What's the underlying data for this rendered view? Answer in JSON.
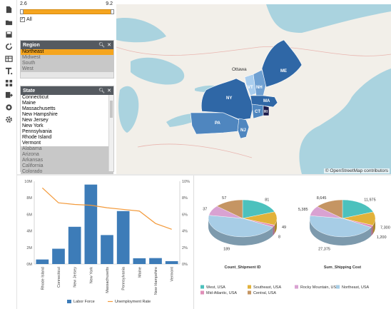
{
  "slider": {
    "min_label": "2.6",
    "max_label": "9.2"
  },
  "all_checkbox": {
    "label": "All",
    "checked": "✓"
  },
  "region_listbox": {
    "title": "Region",
    "items": [
      {
        "label": "Northeast",
        "state": "selected"
      },
      {
        "label": "Midwest",
        "state": "excluded"
      },
      {
        "label": "South",
        "state": "excluded"
      },
      {
        "label": "West",
        "state": "excluded"
      }
    ]
  },
  "state_listbox": {
    "title": "State",
    "items": [
      {
        "label": "Connecticut",
        "state": "possible"
      },
      {
        "label": "Maine",
        "state": "possible"
      },
      {
        "label": "Massachusetts",
        "state": "possible"
      },
      {
        "label": "New Hampshire",
        "state": "possible"
      },
      {
        "label": "New Jersey",
        "state": "possible"
      },
      {
        "label": "New York",
        "state": "possible"
      },
      {
        "label": "Pennsylvania",
        "state": "possible"
      },
      {
        "label": "Rhode Island",
        "state": "possible"
      },
      {
        "label": "Vermont",
        "state": "possible"
      },
      {
        "label": "Alabama",
        "state": "excluded"
      },
      {
        "label": "Arizona",
        "state": "excluded"
      },
      {
        "label": "Arkansas",
        "state": "excluded"
      },
      {
        "label": "California",
        "state": "excluded"
      },
      {
        "label": "Colorado",
        "state": "excluded"
      }
    ]
  },
  "toolbar_icons": [
    "new-sheet-icon",
    "open-folder-icon",
    "save-icon",
    "reload-icon",
    "table-box-icon",
    "text-object-icon",
    "grid-layout-icon",
    "export-icon",
    "network-icon",
    "settings-icon"
  ],
  "map": {
    "attribution": "© OpenStreetMap contributors",
    "city_label": "Ottawa",
    "state_labels": [
      "ME",
      "VT",
      "NH",
      "NY",
      "MA",
      "CT",
      "RI",
      "PA",
      "NJ"
    ],
    "shade_colors": {
      "dark": "#2f67a6",
      "mid": "#4f86bf",
      "light": "#6fa0d2",
      "pale": "#a9cdee",
      "rhode_island": "#1a1a4a"
    }
  },
  "chart_data": [
    {
      "type": "bar",
      "categories": [
        "Rhode Island",
        "Connecticut",
        "New Jersey",
        "New York",
        "Massachusetts",
        "Pennsylvania",
        "Maine",
        "New Hampshire",
        "Vermont"
      ],
      "series": [
        {
          "name": "Labor Force",
          "kind": "bar",
          "axis": "left",
          "color": "#3d7cb8",
          "values": [
            0.55,
            1.85,
            4.5,
            9.6,
            3.5,
            6.4,
            0.7,
            0.72,
            0.35
          ]
        },
        {
          "name": "Unemployment Rate",
          "kind": "line",
          "axis": "right",
          "color": "#f39a3b",
          "values": [
            9.2,
            7.4,
            7.2,
            7.1,
            6.8,
            6.6,
            6.4,
            4.9,
            4.2
          ]
        }
      ],
      "left_axis": {
        "ticks": [
          "0M",
          "2M",
          "4M",
          "6M",
          "8M",
          "10M"
        ],
        "ylim": [
          0,
          10
        ]
      },
      "right_axis": {
        "ticks": [
          "0%",
          "2%",
          "4%",
          "6%",
          "8%",
          "10%"
        ],
        "ylim": [
          0,
          10
        ]
      }
    },
    {
      "type": "pie",
      "title": "Count_Shipment ID",
      "slices": [
        {
          "name": "West, USA",
          "value": 81,
          "label": "81",
          "color": "#4cc1bd"
        },
        {
          "name": "Southeast, USA",
          "value": 49,
          "label": "49",
          "color": "#e2b23a"
        },
        {
          "name": "Mid-Atlantic, USA",
          "value": 8,
          "label": "8",
          "color": "#e08fb8"
        },
        {
          "name": "Northeast, USA",
          "value": 189,
          "label": "189",
          "color": "#a7cde6"
        },
        {
          "name": "Rocky Mountain, USA",
          "value": 37,
          "label": "37",
          "color": "#d9a2d2"
        },
        {
          "name": "Central, USA",
          "value": 57,
          "label": "57",
          "color": "#c59563"
        }
      ]
    },
    {
      "type": "pie",
      "title": "Sum_Shipping Cost",
      "slices": [
        {
          "name": "West, USA",
          "value": 11975,
          "label": "11,975",
          "color": "#4cc1bd"
        },
        {
          "name": "Southeast, USA",
          "value": 7300,
          "label": "7,300",
          "color": "#e2b23a"
        },
        {
          "name": "Mid-Atlantic, USA",
          "value": 1200,
          "label": "1,200",
          "color": "#e08fb8"
        },
        {
          "name": "Northeast, USA",
          "value": 27375,
          "label": "27,375",
          "color": "#a7cde6"
        },
        {
          "name": "Rocky Mountain, USA",
          "value": 5385,
          "label": "5,385",
          "color": "#d9a2d2"
        },
        {
          "name": "Central, USA",
          "value": 8645,
          "label": "8,645",
          "color": "#c59563"
        }
      ]
    }
  ],
  "pie_legend": [
    {
      "label": "West, USA",
      "color": "#4cc1bd"
    },
    {
      "label": "Southeast, USA",
      "color": "#e2b23a"
    },
    {
      "label": "Rocky Mountain, USA",
      "color": "#d9a2d2"
    },
    {
      "label": "Northeast, USA",
      "color": "#a7cde6"
    },
    {
      "label": "Mid-Atlantic, USA",
      "color": "#e08fb8"
    },
    {
      "label": "Central, USA",
      "color": "#c59563"
    }
  ]
}
